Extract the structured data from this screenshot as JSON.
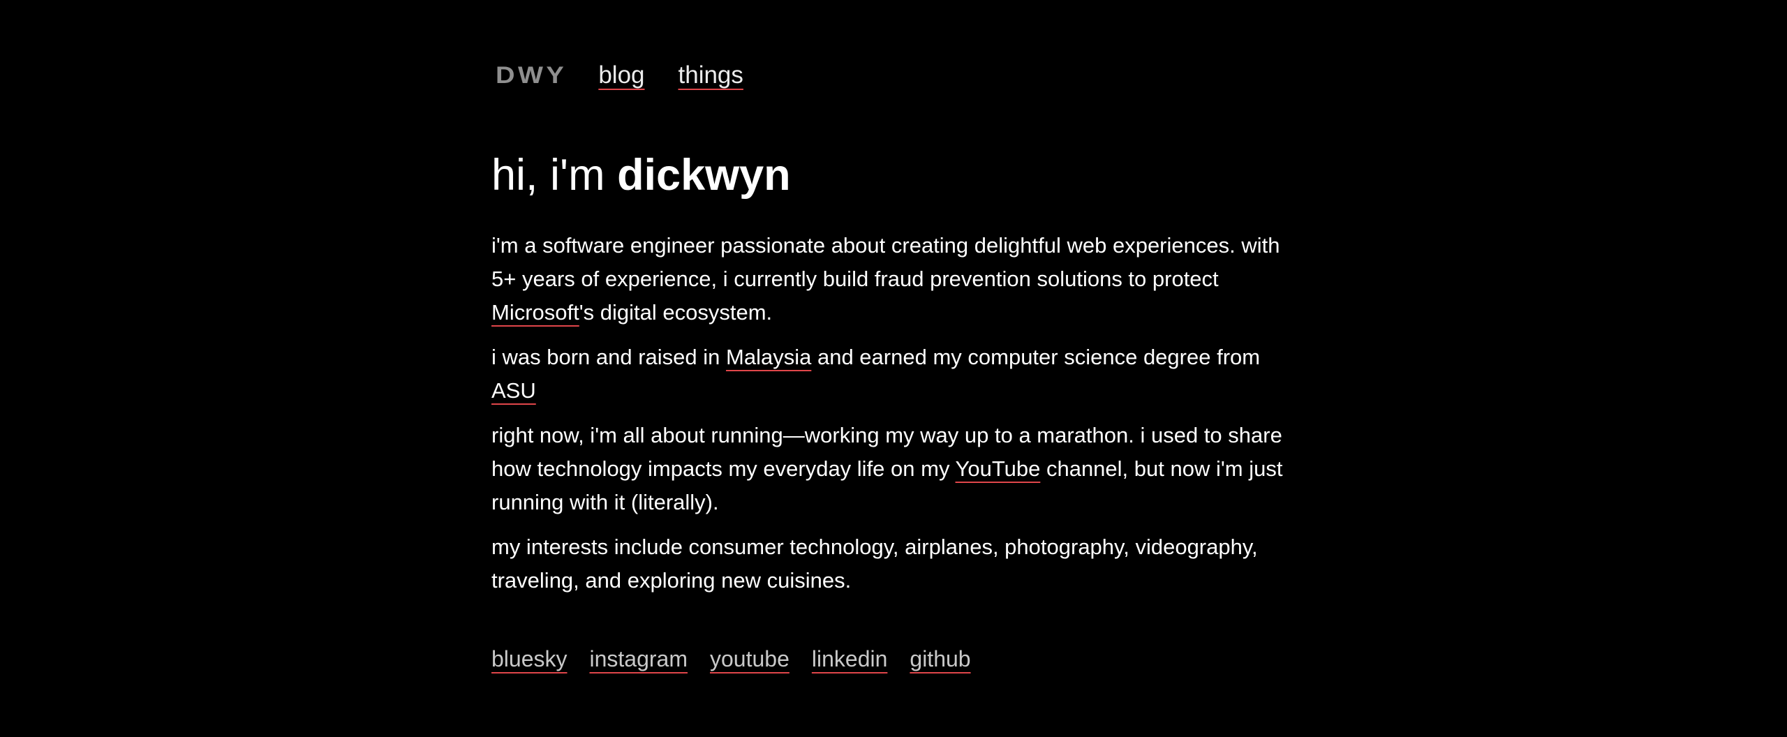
{
  "nav": {
    "logo": "DWY",
    "links": [
      {
        "label": "blog"
      },
      {
        "label": "things"
      }
    ]
  },
  "hero": {
    "greeting": "hi, i'm ",
    "name": "dickwyn"
  },
  "bio": {
    "p1": {
      "text_before": "i'm a software engineer passionate about creating delightful web experiences. with 5+ years of experience, i currently build fraud prevention solutions to protect ",
      "link": "Microsoft",
      "text_after": "'s digital ecosystem."
    },
    "p2": {
      "text_before": "i was born and raised in ",
      "link1": "Malaysia",
      "text_middle": " and earned my computer science degree from ",
      "link2": "ASU"
    },
    "p3": {
      "text_before": "right now, i'm all about running—working my way up to a marathon. i used to share how technology impacts my everyday life on my ",
      "link": "YouTube",
      "text_after": " channel, but now i'm just running with it (literally)."
    },
    "p4": {
      "text": "my interests include consumer technology, airplanes, photography, videography, traveling, and exploring new cuisines."
    }
  },
  "socials": [
    {
      "label": "bluesky"
    },
    {
      "label": "instagram"
    },
    {
      "label": "youtube"
    },
    {
      "label": "linkedin"
    },
    {
      "label": "github"
    }
  ],
  "colors": {
    "background": "#000000",
    "text": "#ffffff",
    "accent_underline": "#e0464a",
    "logo": "#8f8f8f"
  }
}
